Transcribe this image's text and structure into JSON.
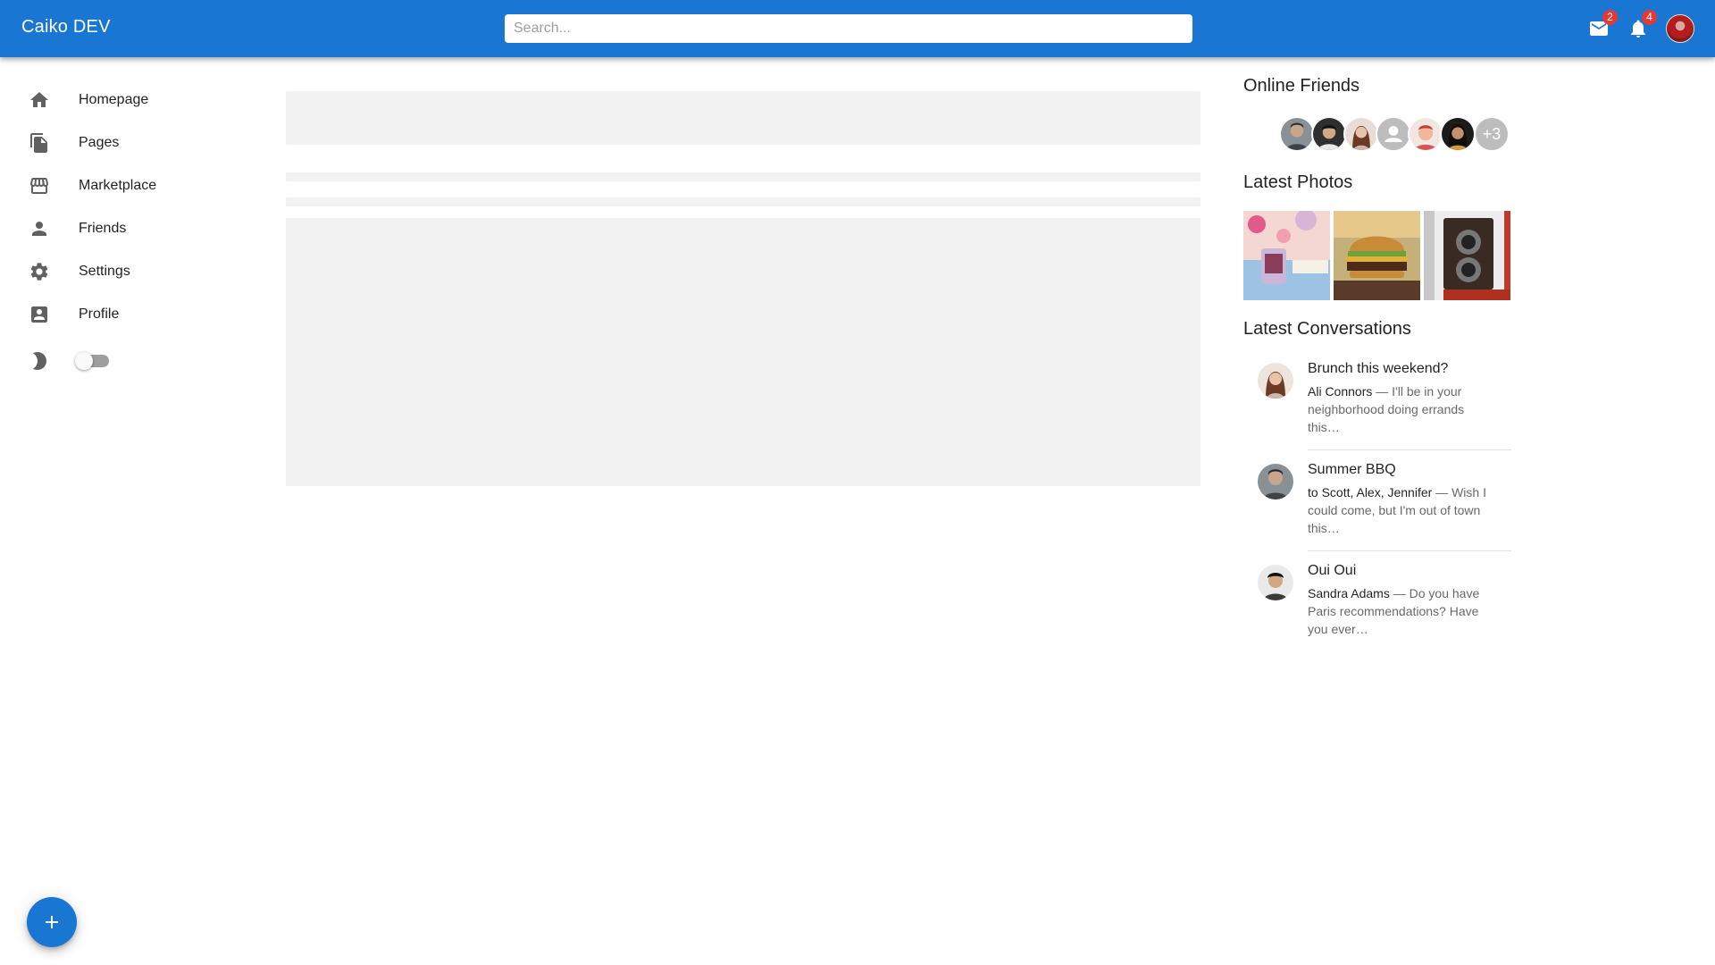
{
  "app": {
    "title": "Caiko DEV"
  },
  "search": {
    "placeholder": "Search..."
  },
  "topbar": {
    "messages": {
      "icon": "mail-icon",
      "badge": "2"
    },
    "notifications": {
      "icon": "bell-icon",
      "badge": "4"
    },
    "avatar": "user-avatar"
  },
  "sidebar": {
    "items": [
      {
        "label": "Homepage",
        "icon": "home-icon"
      },
      {
        "label": "Pages",
        "icon": "file-copy-icon"
      },
      {
        "label": "Marketplace",
        "icon": "storefront-icon"
      },
      {
        "label": "Friends",
        "icon": "person-icon"
      },
      {
        "label": "Settings",
        "icon": "gear-icon"
      },
      {
        "label": "Profile",
        "icon": "account-box-icon"
      }
    ],
    "dark_mode": {
      "icon": "moon-icon",
      "enabled": false
    }
  },
  "right_panel": {
    "online_friends": {
      "title": "Online Friends",
      "more": "+3"
    },
    "latest_photos": {
      "title": "Latest Photos"
    },
    "latest_conversations": {
      "title": "Latest Conversations",
      "items": [
        {
          "title": "Brunch this weekend?",
          "who": "Ali Connors",
          "text": " — I'll be in your neighborhood doing errands this…"
        },
        {
          "title": "Summer BBQ",
          "who": "to Scott, Alex, Jennifer",
          "text": " — Wish I could come, but I'm out of town this…"
        },
        {
          "title": "Oui Oui",
          "who": "Sandra Adams",
          "text": " — Do you have Paris recommendations? Have you ever…"
        }
      ]
    }
  },
  "colors": {
    "primary": "#1976d2",
    "badge": "#e53935",
    "skeleton": "#f2f2f2"
  }
}
